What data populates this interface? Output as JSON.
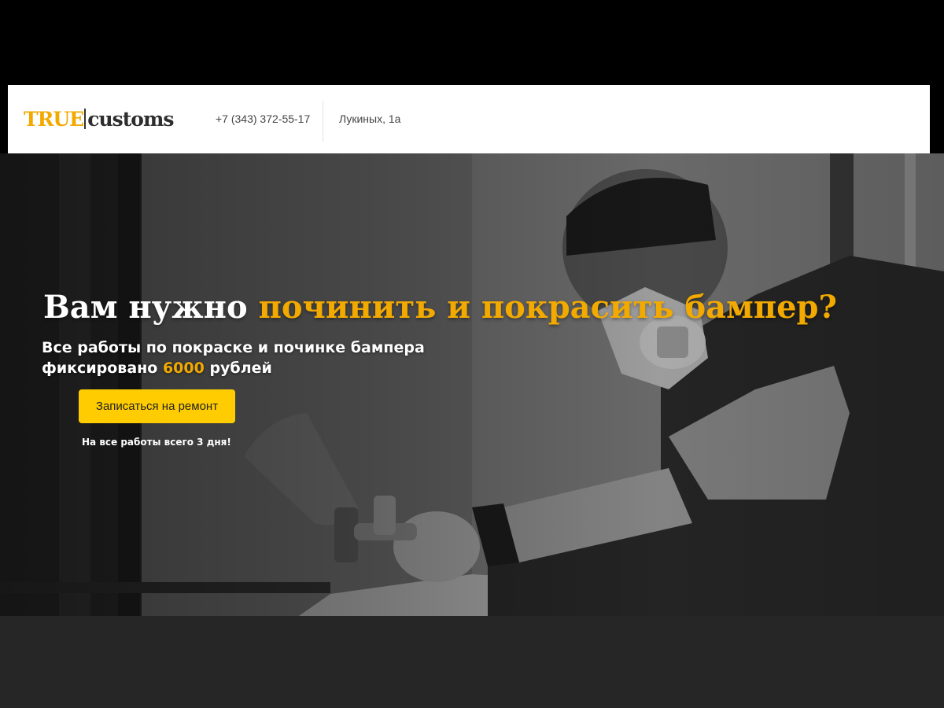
{
  "header": {
    "logo": {
      "part1": "TRUE",
      "part2": "customs"
    },
    "phone": "+7 (343) 372-55-17",
    "address": "Лукиных, 1а"
  },
  "hero": {
    "headline_plain": "Вам нужно ",
    "headline_accent": "починить и покрасить бампер?",
    "subhead_line1": "Все работы по покраске и починке бампера",
    "subhead_line2_prefix": "фиксировано ",
    "subhead_price": "6000",
    "subhead_line2_suffix": " рублей",
    "cta_label": "Записаться на ремонт",
    "note": "На все работы всего 3 дня!",
    "photo_alt": "painter-with-spray-gun-photo"
  },
  "colors": {
    "accent": "#f2a900",
    "button": "#fecc00",
    "footer": "#262626"
  }
}
